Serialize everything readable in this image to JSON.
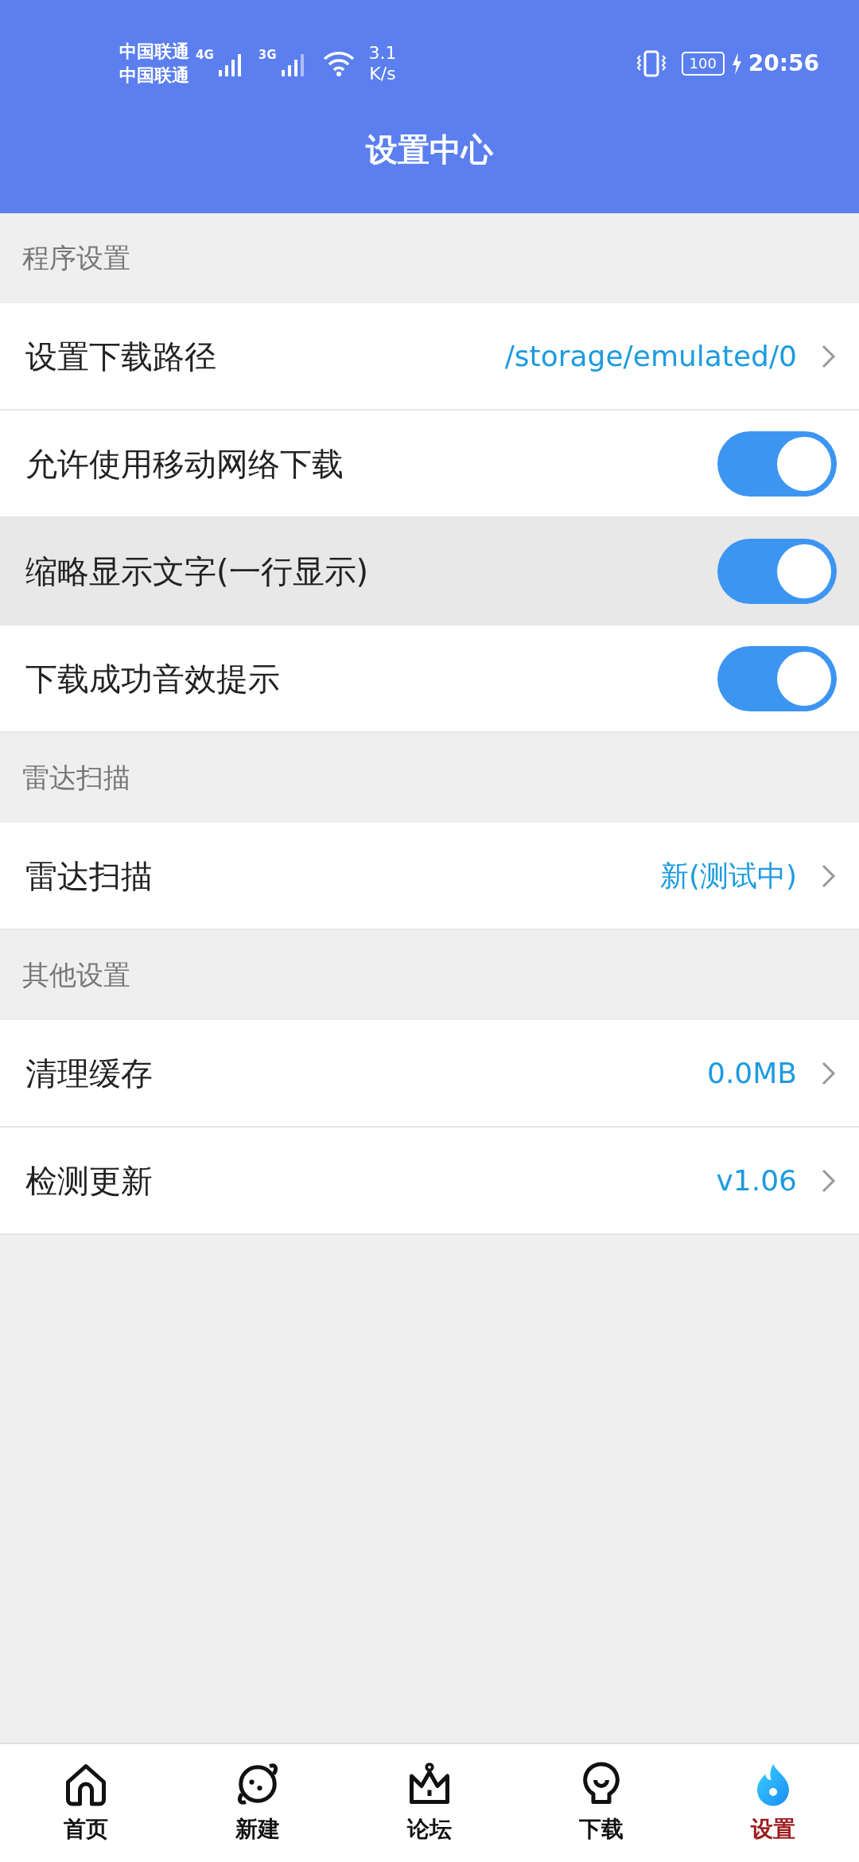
{
  "status_bar": {
    "carriers": [
      "中国联通",
      "中国联通"
    ],
    "network_1": "4G",
    "network_2": "3G",
    "speed_value": "3.1",
    "speed_unit": "K/s",
    "battery": "100",
    "time": "20:56"
  },
  "header": {
    "title": "设置中心"
  },
  "sections": [
    {
      "title": "程序设置",
      "rows": [
        {
          "kind": "link",
          "label": "设置下载路径",
          "value": "/storage/emulated/0",
          "highlighted": false
        },
        {
          "kind": "toggle",
          "label": "允许使用移动网络下载",
          "on": true,
          "highlighted": false
        },
        {
          "kind": "toggle",
          "label": "缩略显示文字(一行显示)",
          "on": true,
          "highlighted": true
        },
        {
          "kind": "toggle",
          "label": "下载成功音效提示",
          "on": true,
          "highlighted": false
        }
      ]
    },
    {
      "title": "雷达扫描",
      "rows": [
        {
          "kind": "link",
          "label": "雷达扫描",
          "value": "新(测试中)",
          "highlighted": false
        }
      ]
    },
    {
      "title": "其他设置",
      "rows": [
        {
          "kind": "link",
          "label": "清理缓存",
          "value": "0.0MB",
          "highlighted": false
        },
        {
          "kind": "link",
          "label": "检测更新",
          "value": "v1.06",
          "highlighted": false
        }
      ]
    }
  ],
  "bottom_nav": [
    {
      "label": "首页",
      "selected": false
    },
    {
      "label": "新建",
      "selected": false
    },
    {
      "label": "论坛",
      "selected": false
    },
    {
      "label": "下载",
      "selected": false
    },
    {
      "label": "设置",
      "selected": true
    }
  ]
}
